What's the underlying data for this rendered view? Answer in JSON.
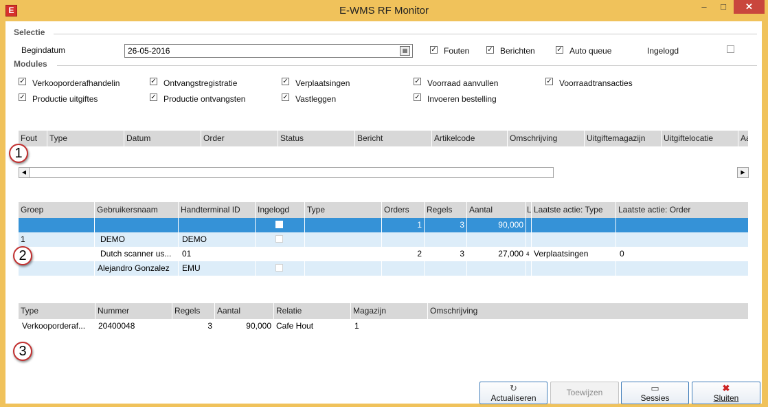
{
  "window": {
    "title": "E-WMS RF Monitor",
    "app_icon_letter": "E",
    "min_glyph": "–",
    "max_glyph": "□",
    "close_glyph": "✕"
  },
  "selectie": {
    "section_title": "Selectie",
    "begindatum_label": "Begindatum",
    "begindatum_value": "26-05-2016",
    "fouten_label": "Fouten",
    "fouten_checked": true,
    "berichten_label": "Berichten",
    "berichten_checked": true,
    "auto_queue_label": "Auto queue",
    "auto_queue_checked": true,
    "ingelogd_label": "Ingelogd",
    "ingelogd_checked": false
  },
  "modules": {
    "section_title": "Modules",
    "items": [
      {
        "label": "Verkooporderafhandelin",
        "checked": true
      },
      {
        "label": "Ontvangstregistratie",
        "checked": true
      },
      {
        "label": "Verplaatsingen",
        "checked": true
      },
      {
        "label": "Voorraad aanvullen",
        "checked": true
      },
      {
        "label": "Voorraadtransacties",
        "checked": true
      },
      {
        "label": "Productie uitgiftes",
        "checked": true
      },
      {
        "label": "Productie ontvangsten",
        "checked": true
      },
      {
        "label": "Vastleggen",
        "checked": true
      },
      {
        "label": "Invoeren bestelling",
        "checked": true
      }
    ]
  },
  "messages_grid": {
    "columns": [
      "Fout",
      "Type",
      "Datum",
      "Order",
      "Status",
      "Bericht",
      "Artikelcode",
      "Omschrijving",
      "Uitgiftemagazijn",
      "Uitgiftelocatie",
      "Aa"
    ]
  },
  "sessions_grid": {
    "columns": [
      "Groep",
      "Gebruikersnaam",
      "Handterminal ID",
      "Ingelogd",
      "Type",
      "Orders",
      "Regels",
      "Aantal",
      "L",
      "Laatste actie: Type",
      "Laatste actie: Order"
    ],
    "rows": [
      [
        "",
        "",
        "",
        "",
        "",
        "1",
        "3",
        "90,000",
        "",
        "",
        ""
      ],
      [
        "1",
        "DEMO",
        "DEMO",
        "",
        "",
        "",
        "",
        "",
        "",
        "",
        ""
      ],
      [
        "",
        "Dutch scanner us...",
        "01",
        "",
        "",
        "2",
        "3",
        "27,000",
        "4",
        "Verplaatsingen",
        "0"
      ],
      [
        "",
        "Alejandro Gonzalez",
        "EMU",
        "",
        "",
        "",
        "",
        "",
        "",
        "",
        ""
      ]
    ]
  },
  "orders_grid": {
    "columns": [
      "Type",
      "Nummer",
      "Regels",
      "Aantal",
      "Relatie",
      "Magazijn",
      "Omschrijving"
    ],
    "rows": [
      [
        "Verkooporderaf...",
        "20400048",
        "3",
        "90,000",
        "Cafe Hout",
        "1",
        ""
      ]
    ]
  },
  "badges": [
    "1",
    "2",
    "3"
  ],
  "buttons": {
    "actualiseren": {
      "label": "Actualiseren",
      "icon": "refresh-icon"
    },
    "toewijzen": {
      "label": "Toewijzen"
    },
    "sessies": {
      "label": "Sessies",
      "icon": "folder-icon"
    },
    "sluiten": {
      "label": "Sluiten",
      "icon": "close-icon"
    }
  }
}
